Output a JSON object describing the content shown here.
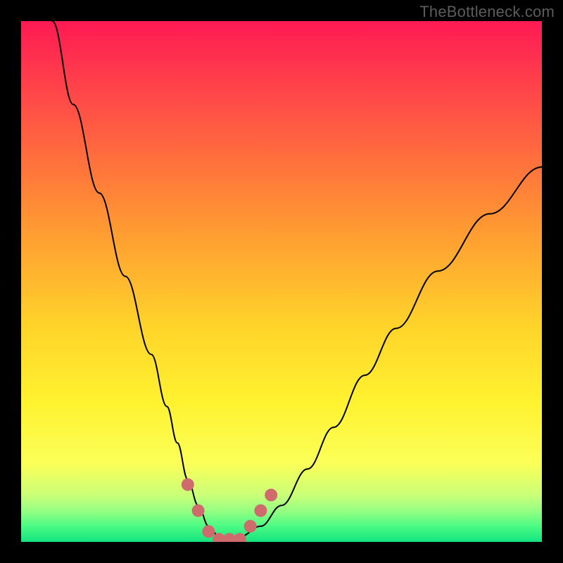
{
  "watermark": "TheBottleneck.com",
  "chart_data": {
    "type": "line",
    "title": "",
    "xlabel": "",
    "ylabel": "",
    "xlim": [
      0,
      100
    ],
    "ylim": [
      0,
      100
    ],
    "series": [
      {
        "name": "black-curve",
        "x": [
          6,
          10,
          15,
          20,
          25,
          28,
          30,
          32,
          34,
          36,
          38,
          40,
          42,
          46,
          50,
          55,
          60,
          66,
          72,
          80,
          90,
          100
        ],
        "values": [
          100,
          84,
          67,
          51,
          36,
          26,
          19,
          12,
          7,
          3,
          1,
          0.5,
          1,
          3,
          7,
          14,
          22,
          32,
          41,
          52,
          63,
          72
        ]
      }
    ],
    "markers": {
      "name": "salmon-dots",
      "color": "#cf6a6d",
      "x": [
        32,
        34,
        36,
        38,
        40,
        42,
        44,
        46,
        48
      ],
      "values": [
        11,
        6,
        2,
        0.5,
        0.5,
        0.5,
        3,
        6,
        9
      ]
    },
    "background_gradient": [
      "#ff1a53",
      "#ff6a3e",
      "#ffd22a",
      "#fbff58",
      "#4bfb84",
      "#12e47f"
    ]
  }
}
